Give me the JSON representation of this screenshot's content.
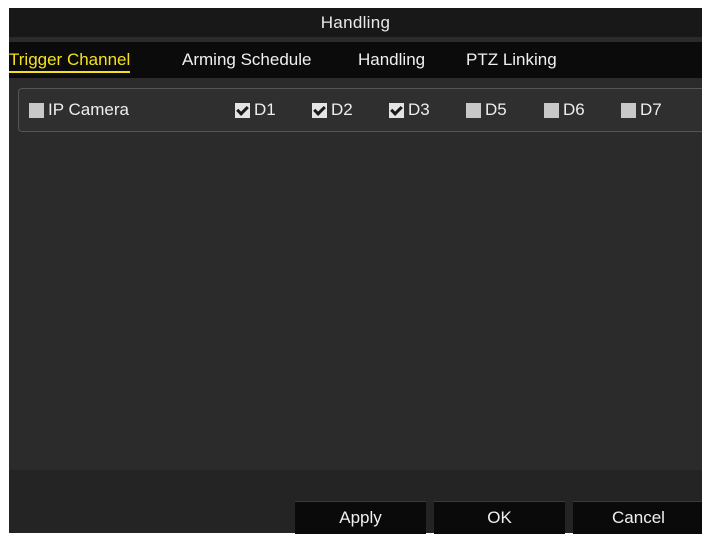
{
  "window": {
    "title": "Handling"
  },
  "tabs": [
    {
      "label": "Trigger Channel",
      "active": true
    },
    {
      "label": "Arming Schedule",
      "active": false
    },
    {
      "label": "Handling",
      "active": false
    },
    {
      "label": "PTZ Linking",
      "active": false
    }
  ],
  "channels": [
    {
      "label": "IP Camera",
      "checked": false
    },
    {
      "label": "D1",
      "checked": true
    },
    {
      "label": "D2",
      "checked": true
    },
    {
      "label": "D3",
      "checked": true
    },
    {
      "label": "D5",
      "checked": false
    },
    {
      "label": "D6",
      "checked": false
    },
    {
      "label": "D7",
      "checked": false
    }
  ],
  "buttons": {
    "apply": "Apply",
    "ok": "OK",
    "cancel": "Cancel"
  },
  "colors": {
    "active_tab": "#f5e020",
    "background": "#2b2b2b",
    "title_bar": "#181818",
    "tab_bar": "#0b0b0b"
  }
}
